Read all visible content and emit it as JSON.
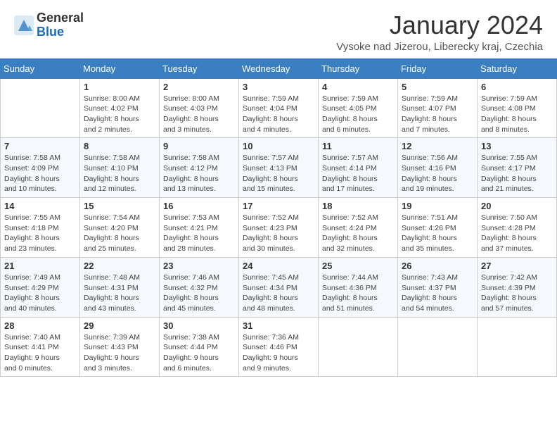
{
  "logo": {
    "general": "General",
    "blue": "Blue"
  },
  "header": {
    "month_title": "January 2024",
    "subtitle": "Vysoke nad Jizerou, Liberecky kraj, Czechia"
  },
  "weekdays": [
    "Sunday",
    "Monday",
    "Tuesday",
    "Wednesday",
    "Thursday",
    "Friday",
    "Saturday"
  ],
  "weeks": [
    [
      {
        "day": "",
        "info": ""
      },
      {
        "day": "1",
        "info": "Sunrise: 8:00 AM\nSunset: 4:02 PM\nDaylight: 8 hours\nand 2 minutes."
      },
      {
        "day": "2",
        "info": "Sunrise: 8:00 AM\nSunset: 4:03 PM\nDaylight: 8 hours\nand 3 minutes."
      },
      {
        "day": "3",
        "info": "Sunrise: 7:59 AM\nSunset: 4:04 PM\nDaylight: 8 hours\nand 4 minutes."
      },
      {
        "day": "4",
        "info": "Sunrise: 7:59 AM\nSunset: 4:05 PM\nDaylight: 8 hours\nand 6 minutes."
      },
      {
        "day": "5",
        "info": "Sunrise: 7:59 AM\nSunset: 4:07 PM\nDaylight: 8 hours\nand 7 minutes."
      },
      {
        "day": "6",
        "info": "Sunrise: 7:59 AM\nSunset: 4:08 PM\nDaylight: 8 hours\nand 8 minutes."
      }
    ],
    [
      {
        "day": "7",
        "info": "Sunrise: 7:58 AM\nSunset: 4:09 PM\nDaylight: 8 hours\nand 10 minutes."
      },
      {
        "day": "8",
        "info": "Sunrise: 7:58 AM\nSunset: 4:10 PM\nDaylight: 8 hours\nand 12 minutes."
      },
      {
        "day": "9",
        "info": "Sunrise: 7:58 AM\nSunset: 4:12 PM\nDaylight: 8 hours\nand 13 minutes."
      },
      {
        "day": "10",
        "info": "Sunrise: 7:57 AM\nSunset: 4:13 PM\nDaylight: 8 hours\nand 15 minutes."
      },
      {
        "day": "11",
        "info": "Sunrise: 7:57 AM\nSunset: 4:14 PM\nDaylight: 8 hours\nand 17 minutes."
      },
      {
        "day": "12",
        "info": "Sunrise: 7:56 AM\nSunset: 4:16 PM\nDaylight: 8 hours\nand 19 minutes."
      },
      {
        "day": "13",
        "info": "Sunrise: 7:55 AM\nSunset: 4:17 PM\nDaylight: 8 hours\nand 21 minutes."
      }
    ],
    [
      {
        "day": "14",
        "info": "Sunrise: 7:55 AM\nSunset: 4:18 PM\nDaylight: 8 hours\nand 23 minutes."
      },
      {
        "day": "15",
        "info": "Sunrise: 7:54 AM\nSunset: 4:20 PM\nDaylight: 8 hours\nand 25 minutes."
      },
      {
        "day": "16",
        "info": "Sunrise: 7:53 AM\nSunset: 4:21 PM\nDaylight: 8 hours\nand 28 minutes."
      },
      {
        "day": "17",
        "info": "Sunrise: 7:52 AM\nSunset: 4:23 PM\nDaylight: 8 hours\nand 30 minutes."
      },
      {
        "day": "18",
        "info": "Sunrise: 7:52 AM\nSunset: 4:24 PM\nDaylight: 8 hours\nand 32 minutes."
      },
      {
        "day": "19",
        "info": "Sunrise: 7:51 AM\nSunset: 4:26 PM\nDaylight: 8 hours\nand 35 minutes."
      },
      {
        "day": "20",
        "info": "Sunrise: 7:50 AM\nSunset: 4:28 PM\nDaylight: 8 hours\nand 37 minutes."
      }
    ],
    [
      {
        "day": "21",
        "info": "Sunrise: 7:49 AM\nSunset: 4:29 PM\nDaylight: 8 hours\nand 40 minutes."
      },
      {
        "day": "22",
        "info": "Sunrise: 7:48 AM\nSunset: 4:31 PM\nDaylight: 8 hours\nand 43 minutes."
      },
      {
        "day": "23",
        "info": "Sunrise: 7:46 AM\nSunset: 4:32 PM\nDaylight: 8 hours\nand 45 minutes."
      },
      {
        "day": "24",
        "info": "Sunrise: 7:45 AM\nSunset: 4:34 PM\nDaylight: 8 hours\nand 48 minutes."
      },
      {
        "day": "25",
        "info": "Sunrise: 7:44 AM\nSunset: 4:36 PM\nDaylight: 8 hours\nand 51 minutes."
      },
      {
        "day": "26",
        "info": "Sunrise: 7:43 AM\nSunset: 4:37 PM\nDaylight: 8 hours\nand 54 minutes."
      },
      {
        "day": "27",
        "info": "Sunrise: 7:42 AM\nSunset: 4:39 PM\nDaylight: 8 hours\nand 57 minutes."
      }
    ],
    [
      {
        "day": "28",
        "info": "Sunrise: 7:40 AM\nSunset: 4:41 PM\nDaylight: 9 hours\nand 0 minutes."
      },
      {
        "day": "29",
        "info": "Sunrise: 7:39 AM\nSunset: 4:43 PM\nDaylight: 9 hours\nand 3 minutes."
      },
      {
        "day": "30",
        "info": "Sunrise: 7:38 AM\nSunset: 4:44 PM\nDaylight: 9 hours\nand 6 minutes."
      },
      {
        "day": "31",
        "info": "Sunrise: 7:36 AM\nSunset: 4:46 PM\nDaylight: 9 hours\nand 9 minutes."
      },
      {
        "day": "",
        "info": ""
      },
      {
        "day": "",
        "info": ""
      },
      {
        "day": "",
        "info": ""
      }
    ]
  ]
}
